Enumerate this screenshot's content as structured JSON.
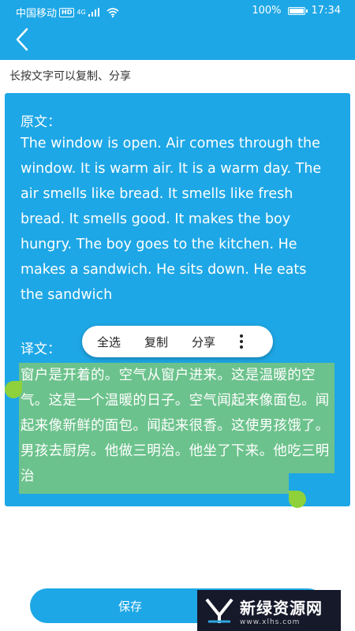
{
  "status_bar": {
    "carrier": "中国移动",
    "hd_badge": "HD",
    "network": "4G",
    "battery_percent": "100%",
    "battery_level": 1.0,
    "time": "17:34"
  },
  "header": {
    "back_icon": "chevron-left-icon"
  },
  "hint_text": "长按文字可以复制、分享",
  "original": {
    "label": "原文：",
    "text": "The window is open. Air comes through the window. It is warm air. It is a warm day. The air smells like bread. It smells like fresh bread. It smells good. It makes the boy hungry. The boy goes to the kitchen. He makes a sandwich. He sits down. He eats the sandwich"
  },
  "translation": {
    "label": "译文：",
    "text": "窗户是开着的。空气从窗户进来。这是温暖的空气。这是一个温暖的日子。空气闻起来像面包。闻起来像新鲜的面包。闻起来很香。这使男孩饿了。男孩去厨房。他做三明治。他坐了下来。他吃三明治"
  },
  "context_menu": {
    "select_all": "全选",
    "copy": "复制",
    "share": "分享",
    "more_icon": "more-vertical-icon"
  },
  "save_button": "保存",
  "watermark": {
    "title": "新绿资源网",
    "url": "www.xlhs.com"
  },
  "colors": {
    "accent": "#1ea7e6",
    "selection": "#6cc28c",
    "handle": "#8ed13a"
  }
}
